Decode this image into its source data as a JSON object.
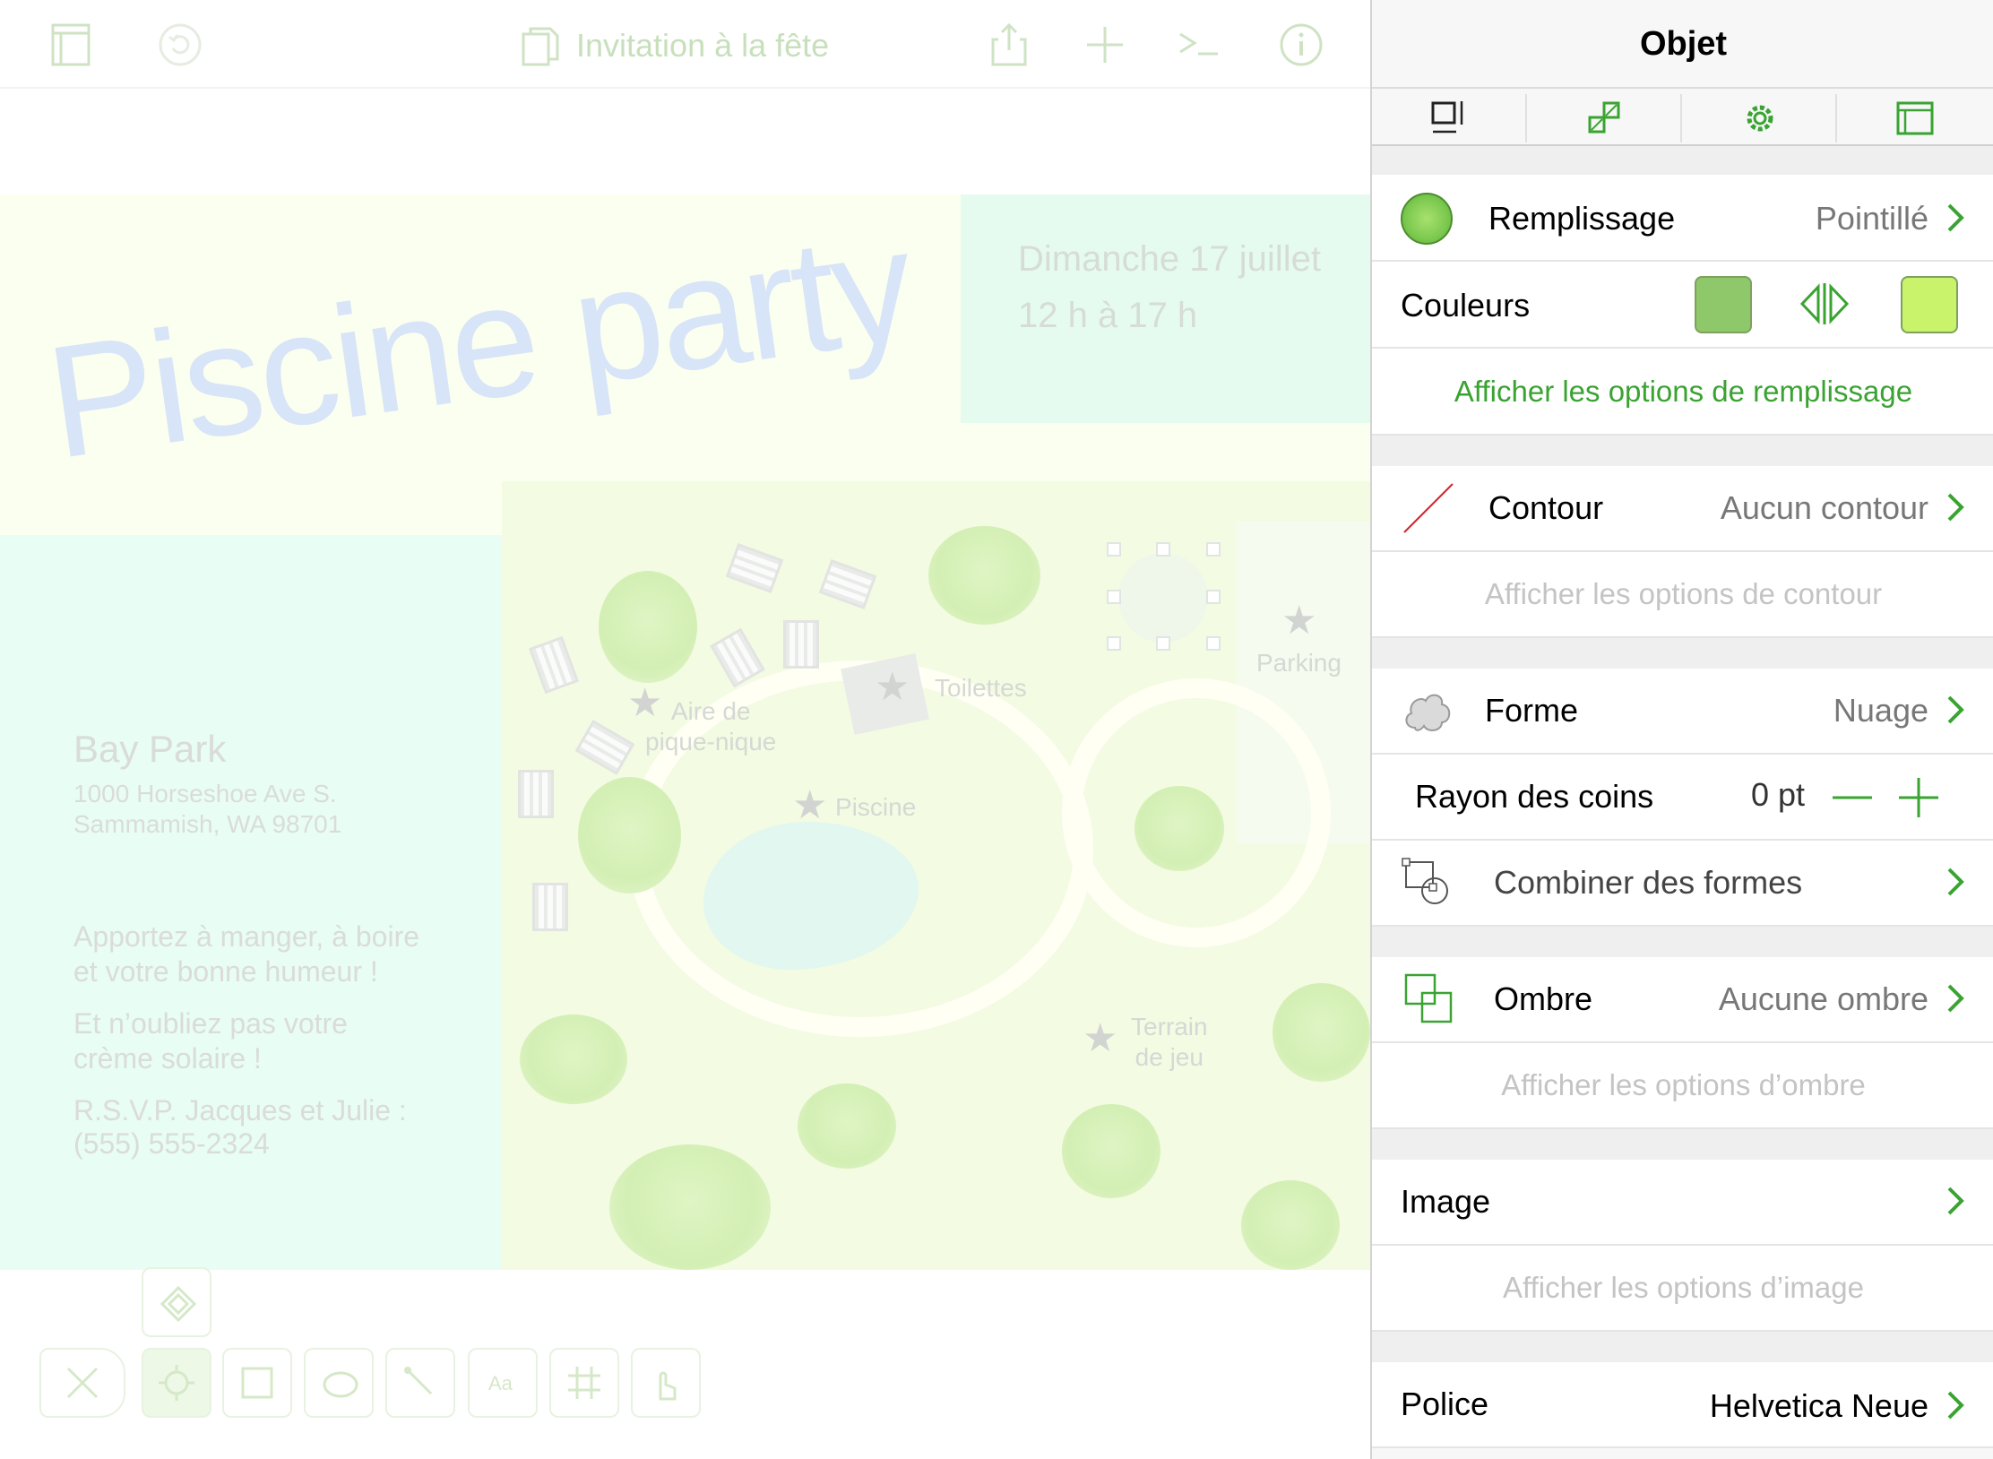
{
  "toolbar": {
    "document_title": "Invitation à la fête",
    "icons": [
      "sidebar-icon",
      "undo-icon",
      "document-icon",
      "share-icon",
      "add-icon",
      "console-icon",
      "info-icon"
    ]
  },
  "artboard": {
    "headline": "Piscine party",
    "date_line1": "Dimanche 17 juillet",
    "date_line2": "12 h à 17 h",
    "venue": "Bay Park",
    "address_line1": "1000 Horseshoe Ave S.",
    "address_line2": "Sammamish, WA 98701",
    "note1_line1": "Apportez à manger, à boire",
    "note1_line2": "et votre bonne humeur !",
    "note2_line1": "Et n’oubliez pas votre",
    "note2_line2": "crème solaire !",
    "rsvp_line1": "R.S.V.P. Jacques et Julie :",
    "rsvp_line2": "(555) 555-2324",
    "map_labels": {
      "picnic_line1": "Aire de",
      "picnic_line2": "pique-nique",
      "toilets": "Toilettes",
      "parking": "Parking",
      "pool": "Piscine",
      "playground_line1": "Terrain",
      "playground_line2": "de jeu"
    }
  },
  "tools": {
    "items": [
      "eraser-tool",
      "selection-tool",
      "shape-tool",
      "lasso-tool",
      "pen-tool",
      "text-tool",
      "diagram-tool",
      "hand-tool"
    ],
    "active": "selection-tool",
    "extra": "point-editor-tool"
  },
  "inspector": {
    "title": "Objet",
    "tabs": [
      "geometry-tab",
      "arrange-tab",
      "settings-tab",
      "canvas-tab"
    ],
    "fill": {
      "label": "Remplissage",
      "value": "Pointillé",
      "link": "Afficher les options de remplissage"
    },
    "colors": {
      "label": "Couleurs",
      "color1": "#8ec86a",
      "color2": "#c9f36a"
    },
    "stroke": {
      "label": "Contour",
      "value": "Aucun contour",
      "link": "Afficher les options de contour"
    },
    "shape": {
      "label": "Forme",
      "value": "Nuage"
    },
    "corner_radius": {
      "label": "Rayon des coins",
      "value": "0 pt"
    },
    "combine": {
      "label": "Combiner des formes"
    },
    "shadow": {
      "label": "Ombre",
      "value": "Aucune ombre",
      "link": "Afficher les options d’ombre"
    },
    "image": {
      "label": "Image",
      "link": "Afficher les options d’image"
    },
    "font": {
      "label": "Police",
      "value": "Helvetica Neue"
    },
    "accent_color": "#3aa332"
  }
}
